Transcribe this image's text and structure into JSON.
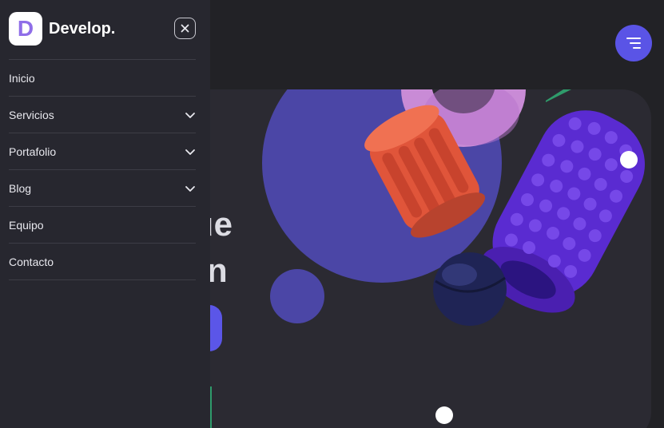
{
  "brand": {
    "logo_letter": "D",
    "name": "Develop."
  },
  "drawer": {
    "close_icon": "close-icon",
    "items": [
      {
        "label": "Inicio",
        "has_submenu": false
      },
      {
        "label": "Servicios",
        "has_submenu": true
      },
      {
        "label": "Portafolio",
        "has_submenu": true
      },
      {
        "label": "Blog",
        "has_submenu": true
      },
      {
        "label": "Equipo",
        "has_submenu": false
      },
      {
        "label": "Contacto",
        "has_submenu": false
      }
    ]
  },
  "header": {
    "menu_icon": "hamburger-icon"
  },
  "hero": {
    "title_line1": "web que",
    "title_line2": "erten"
  },
  "colors": {
    "accent": "#5a54e6",
    "drawer_bg": "#27272f",
    "page_bg": "#222226",
    "hero_bg": "#2b2a32"
  }
}
